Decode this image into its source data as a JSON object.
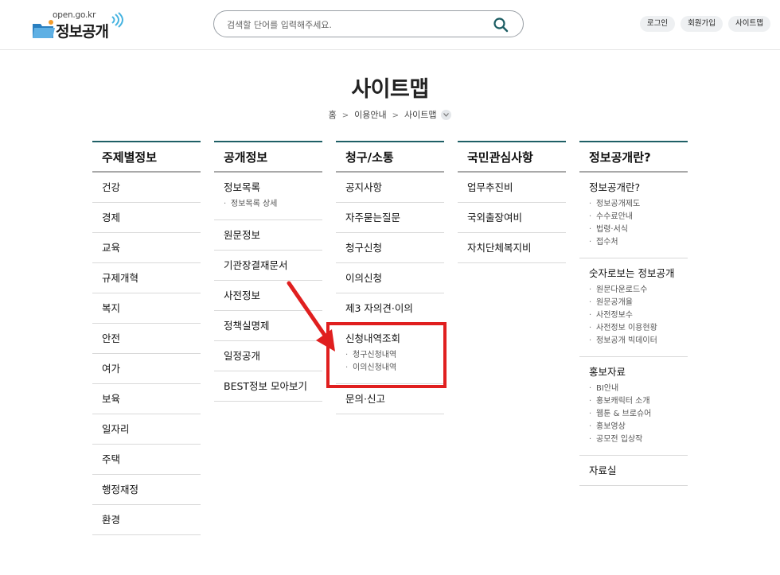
{
  "header": {
    "logo_url": "open.go.kr",
    "logo_title": "정보공개",
    "search_placeholder": "검색할 단어를 입력해주세요.",
    "links": [
      "로그인",
      "회원가입",
      "사이트맵"
    ]
  },
  "page": {
    "title": "사이트맵",
    "breadcrumb": [
      "홈",
      "이용안내",
      "사이트맵"
    ]
  },
  "columns": [
    {
      "heading": "주제별정보",
      "items": [
        {
          "label": "건강"
        },
        {
          "label": "경제"
        },
        {
          "label": "교육"
        },
        {
          "label": "규제개혁"
        },
        {
          "label": "복지"
        },
        {
          "label": "안전"
        },
        {
          "label": "여가"
        },
        {
          "label": "보육"
        },
        {
          "label": "일자리"
        },
        {
          "label": "주택"
        },
        {
          "label": "행정재정"
        },
        {
          "label": "환경"
        }
      ]
    },
    {
      "heading": "공개정보",
      "items": [
        {
          "label": "정보목록",
          "sub": [
            "정보목록 상세"
          ]
        },
        {
          "label": "원문정보"
        },
        {
          "label": "기관장결재문서"
        },
        {
          "label": "사전정보"
        },
        {
          "label": "정책실명제"
        },
        {
          "label": "일정공개"
        },
        {
          "label": "BEST정보 모아보기"
        }
      ]
    },
    {
      "heading": "청구/소통",
      "items": [
        {
          "label": "공지사항"
        },
        {
          "label": "자주묻는질문"
        },
        {
          "label": "청구신청"
        },
        {
          "label": "이의신청"
        },
        {
          "label": "제3 자의견·이의"
        },
        {
          "label": "신청내역조회",
          "sub": [
            "청구신청내역",
            "이의신청내역"
          ]
        },
        {
          "label": "문의·신고"
        }
      ]
    },
    {
      "heading": "국민관심사항",
      "items": [
        {
          "label": "업무추진비"
        },
        {
          "label": "국외출장여비"
        },
        {
          "label": "자치단체복지비"
        }
      ]
    },
    {
      "heading": "정보공개란?",
      "items": [
        {
          "label": "정보공개란?",
          "sub": [
            "정보공개제도",
            "수수료안내",
            "법령·서식",
            "접수처"
          ]
        },
        {
          "label": "숫자로보는 정보공개",
          "sub": [
            "원문다운로드수",
            "원문공개율",
            "사전정보수",
            "사전정보 이용현황",
            "정보공개 빅데이터"
          ]
        },
        {
          "label": "홍보자료",
          "sub": [
            "BI안내",
            "홍보캐릭터 소개",
            "웹툰 & 브로슈어",
            "홍보영상",
            "공모전 입상작"
          ]
        },
        {
          "label": "자료실"
        }
      ]
    }
  ],
  "colors": {
    "accent_line": "#1f5f66",
    "highlight": "#e01f1f"
  }
}
